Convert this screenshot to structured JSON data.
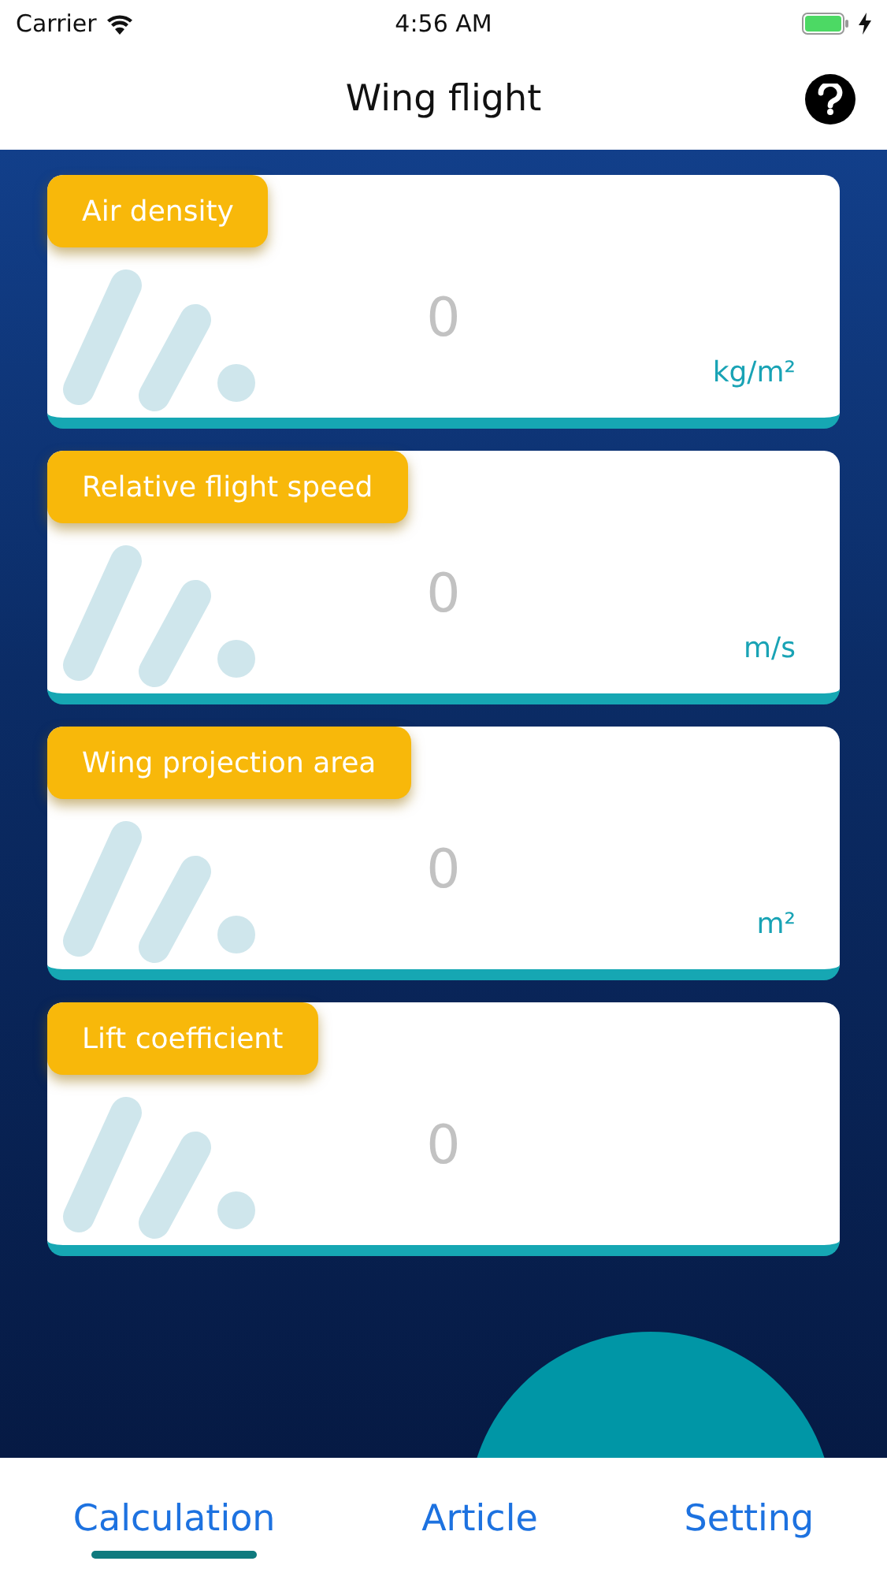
{
  "status_bar": {
    "carrier": "Carrier",
    "time": "4:56 AM"
  },
  "nav": {
    "title": "Wing flight"
  },
  "fields": [
    {
      "label": "Air density",
      "value": "0",
      "unit": "kg/m²"
    },
    {
      "label": "Relative flight speed",
      "value": "0",
      "unit": "m/s"
    },
    {
      "label": "Wing projection area",
      "value": "0",
      "unit": "m²"
    },
    {
      "label": "Lift coefficient",
      "value": "0"
    }
  ],
  "tabs": [
    {
      "label": "Calculation",
      "selected": true
    },
    {
      "label": "Article",
      "selected": false
    },
    {
      "label": "Setting",
      "selected": false
    }
  ]
}
